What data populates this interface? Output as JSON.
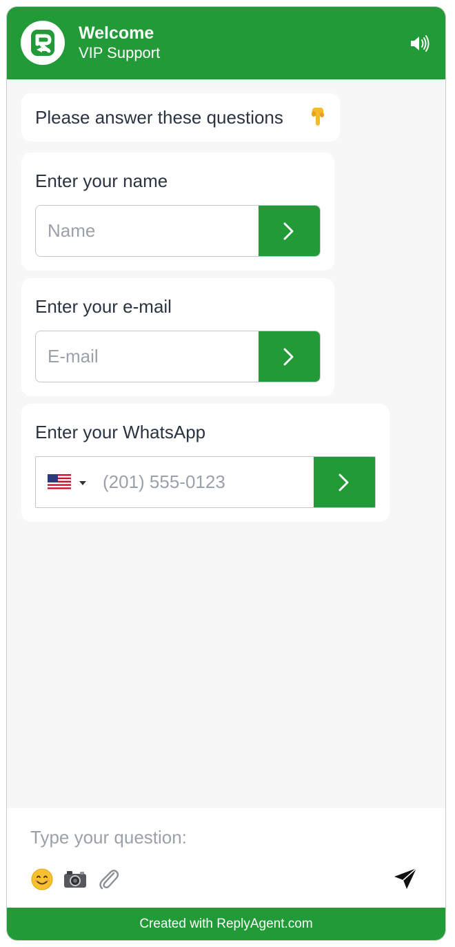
{
  "header": {
    "title": "Welcome",
    "subtitle": "VIP Support",
    "logo_icon": "replyagent-logo-icon",
    "sound_icon": "speaker-icon"
  },
  "intro": {
    "text": "Please answer these questions",
    "emoji": "pointing-down-hand-icon"
  },
  "form": {
    "name": {
      "label": "Enter your name",
      "placeholder": "Name",
      "value": ""
    },
    "email": {
      "label": "Enter your e-mail",
      "placeholder": "E-mail",
      "value": ""
    },
    "whatsapp": {
      "label": "Enter your WhatsApp",
      "placeholder": "(201) 555-0123",
      "value": "",
      "country_flag": "us-flag-icon"
    },
    "submit_icon": "chevron-right-icon"
  },
  "composer": {
    "placeholder": "Type your question:",
    "value": "",
    "tools": [
      "smiley-emoji-icon",
      "camera-icon",
      "paperclip-icon"
    ],
    "send_icon": "paper-plane-icon"
  },
  "footer": {
    "text": "Created with ReplyAgent.com"
  },
  "colors": {
    "brand_green": "#229a37",
    "text": "#2a3342",
    "placeholder": "#9aa1aa",
    "chat_bg": "#f7f7f7"
  }
}
